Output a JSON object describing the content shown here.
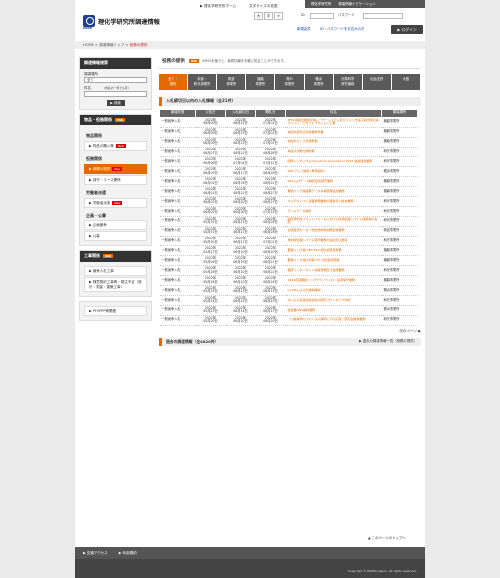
{
  "header": {
    "logo_text": "RIKEN",
    "title": "理化学研究所調達情報",
    "top_link": "▶ 理化学研究所ホーム",
    "font_size_label": "文字サイズの変更",
    "font_sizes": [
      "大",
      "中",
      "小"
    ],
    "bar_items": [
      "理化学研究所",
      "調達情報ナビゲーション"
    ],
    "id_label": "ID",
    "password_label": "パスワード",
    "register_link": "新規会員",
    "forgot_link": "ID・パスワードをお忘れの方",
    "login_button": "▶ ログイン"
  },
  "breadcrumb": {
    "home": "HOME",
    "mid": "調達情報トップ",
    "current": "役務の提供"
  },
  "sidebar": {
    "search_title": "調達情報検索",
    "place_label": "調達場所",
    "place_value": "全て",
    "subject_label": "件名",
    "subject_hint": "(件名の一部でも可)",
    "search_button": "▶ 検索",
    "goods_title": "物品・役務関係",
    "rss": "RSS",
    "cat1": "物品関係",
    "cat1_items": [
      "物品の購入等"
    ],
    "cat2": "役務関係",
    "cat2_items": [
      "役務の提供",
      "保守・リース関係"
    ],
    "cat3": "労働者派遣",
    "cat3_items": [
      "労働者派遣"
    ],
    "cat4": "企画・公募",
    "cat4_items": [
      "企画競争",
      "公募"
    ],
    "works_title": "工事関係",
    "works_items": [
      "競争入札工事",
      "随意契約工事等・発注予定（設計・測量・建築工事）"
    ],
    "ppi_item": "PFI/PPP等関連",
    "new_badge": "New"
  },
  "main": {
    "title": "役務の提供",
    "rss": "RSS",
    "rss_desc": "※RSSを使うと、新着情報を手軽に知ることができます。",
    "tabs": [
      "全て・\n提供",
      "本部・\n和光事業所",
      "筑波\n事業所",
      "播磨\n事業所",
      "神戸\n事業所",
      "横浜\n事業所",
      "計算科学\n研究機構",
      "仙台支所",
      "大阪"
    ],
    "section1": "入札締切日以内の入札情報（全21件）",
    "columns": [
      "調達形態",
      "公告日",
      "入札締切日",
      "開札日",
      "件名",
      "調達場所"
    ],
    "rows": [
      [
        "一般競争入札",
        "2022年\n06月09日",
        "2022年\n06月22日",
        "2022年\n07月01日",
        "XFEL用検出器用交換レーザーシステム及びライン光電子検出用高速ブリッジ・エクストラクション工事",
        "播磨事業所"
      ],
      [
        "一般競争入札",
        "2022年\n06月09日",
        "2022年\n06月23日",
        "2022年\n07月01日",
        "本館外装周辺清掃業務作業",
        "播磨事業所"
      ],
      [
        "一般競争入札",
        "2022年\n06月09日",
        "2022年\n06月23日",
        "2022年\n07月01日",
        "本館外ポンプ点検整備",
        "播磨事業所"
      ],
      [
        "一般競争入札",
        "2022年\n06月07日",
        "2022年\n06月21日",
        "2022年\n06月28日",
        "本館冷凍機分解整備",
        "和光事業所"
      ],
      [
        "一般競争入札",
        "2022年\n06月06日",
        "2022年\n07月04日",
        "2022年\n07月21日",
        "国際シンポジウム(Quantum Innovation) 2022 会議運営業務",
        "和光事業所"
      ],
      [
        "一般競争入札",
        "2022年\n06月03日",
        "2022年\n06月17日",
        "2022年\n06月28日",
        "SNP アレイ解析 (単価契約)",
        "横浜事業所"
      ],
      [
        "一般競争入札",
        "2022年\n06月02日",
        "2022年\n06月16日",
        "2022年\n06月22日",
        "SPring-8データ解析装置保守業務",
        "播磨事業所"
      ],
      [
        "一般競争入札",
        "2022年\n06月01日",
        "2022年\n06月21日",
        "2022年\n06月27日",
        "蓄積リング棟設備データ系等整備追加業務",
        "播磨事業所"
      ],
      [
        "一般競争入札",
        "2022年\n06月01日",
        "2022年\n06月20日",
        "2022年\n06月27日",
        "マルチキャスト基盤整備業務の更新及び拡充業務",
        "和光事業所"
      ],
      [
        "一般競争入札",
        "2022年\n06月01日",
        "2022年\n06月30日",
        "2022年\n07月15日",
        "ゲノムデータ解析",
        "和光事業所"
      ],
      [
        "一般競争入札",
        "2022年\n05月31日",
        "2022年\n06月21日",
        "2022年\n06月28日",
        "脳科学総合プラットフォームにおける情報処理システム運用等の実施",
        "和光事業所"
      ],
      [
        "一般競争入札",
        "2022年\n05月31日",
        "2022年\n06月21日",
        "2022年\n06月28日",
        "生物資源センター微生物材料開発室等業務",
        "筑波事業所"
      ],
      [
        "一般競争入札",
        "2022年\n05月30日",
        "2022年\n06月21日",
        "2022年\n07月01日",
        "放射線管理システム保守業務の追加及び更新",
        "和光事業所"
      ],
      [
        "一般競争入札",
        "2022年\n05月27日",
        "2022年\n06月10日",
        "2022年\n06月20日",
        "蓄積リング棟 HEX-ESA-用分析装置整備",
        "播磨事業所"
      ],
      [
        "一般競争入札",
        "2022年\n05月26日",
        "2022年\n06月16日",
        "2022年\n06月21日",
        "蓄積リング棟冷却塔CTC 分析装置整備",
        "播磨事業所"
      ],
      [
        "一般競争入札",
        "2022年\n05月26日",
        "2022年\n06月10日",
        "2022年\n06月22日",
        "理研インターネット基盤整備及び運用業務",
        "和光事業所"
      ],
      [
        "一般競争入札",
        "2022年\n05月26日",
        "2022年\n06月10日",
        "2022年\n06月16日",
        "2022年度蓄積リングクライストロン電源保守業務",
        "播磨事業所"
      ],
      [
        "一般競争入札",
        "2022年\n05月25日",
        "2022年\n06月13日",
        "2022年\n06月15日",
        "LC-MSによる代謝物解析",
        "横浜事業所"
      ],
      [
        "一般競争入札",
        "2022年\n05月24日",
        "2022年\n06月14日",
        "2022年\n06月23日",
        "AIによる多目的最適化の研究プロトタイプ作成",
        "和光事業所"
      ],
      [
        "一般競争入札",
        "2022年\n05月23日",
        "2022年\n06月14日",
        "2022年\n06月17日",
        "運営業DNA解析業務",
        "横浜事業所"
      ],
      [
        "一般競争入札",
        "2022年\n05月20日",
        "2022年\n06月10日",
        "2022年\n06月20日",
        "「心臓病学のメカニズム解明とその応用」研究会事務業務",
        "和光事業所"
      ]
    ],
    "more": "次のページ ▶",
    "section2": "過去の調達情報（全4820件）",
    "section2_link": "▶ 過去の調達情報一覧（役務の提供）"
  },
  "pagetop": "▲ このページのトップへ",
  "footer": {
    "links": [
      "▶ 交通アクセス",
      "▶ 利用規約"
    ],
    "copyright": "Copyright © RIKEN, Japan. All rights reserved."
  }
}
